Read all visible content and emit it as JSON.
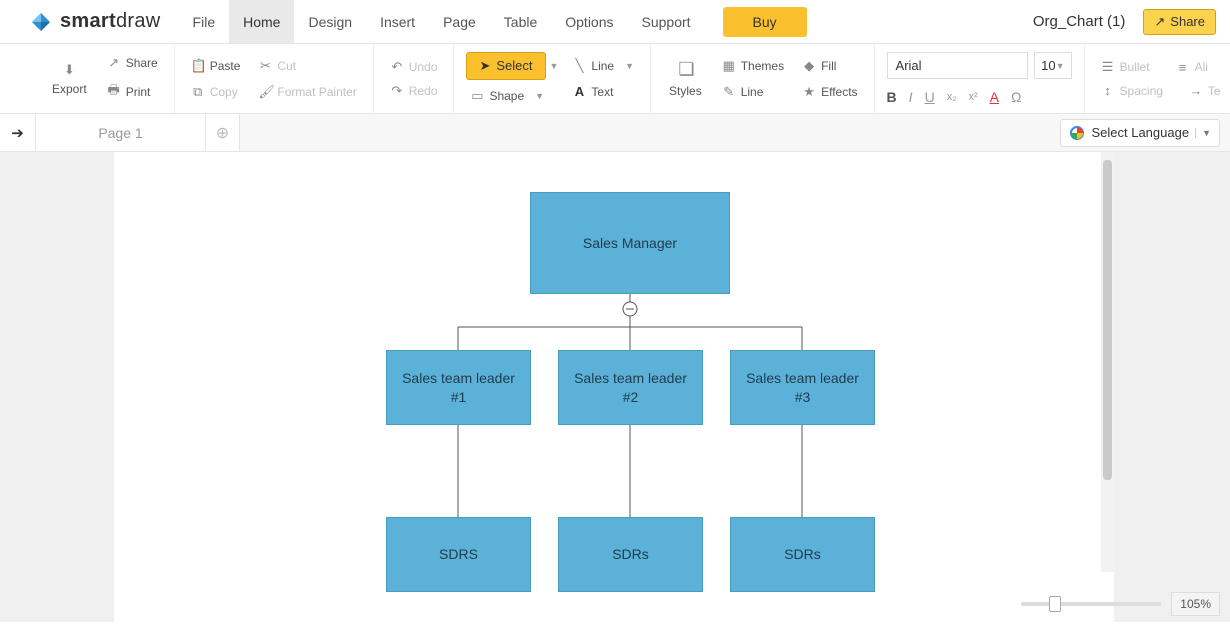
{
  "app": {
    "logo_name_1": "smart",
    "logo_name_2": "draw"
  },
  "menu": {
    "file": "File",
    "home": "Home",
    "design": "Design",
    "insert": "Insert",
    "page": "Page",
    "table": "Table",
    "options": "Options",
    "support": "Support",
    "buy": "Buy"
  },
  "top_right": {
    "doc_title": "Org_Chart (1)",
    "share": "Share"
  },
  "ribbon": {
    "export": "Export",
    "share": "Share",
    "print": "Print",
    "paste": "Paste",
    "cut": "Cut",
    "copy": "Copy",
    "format_painter": "Format Painter",
    "undo": "Undo",
    "redo": "Redo",
    "select": "Select",
    "shape": "Shape",
    "line": "Line",
    "text": "Text",
    "styles": "Styles",
    "themes": "Themes",
    "fill": "Fill",
    "line2": "Line",
    "effects": "Effects",
    "font": "Arial",
    "font_size": "10",
    "bullet": "Bullet",
    "align": "Ali",
    "spacing": "Spacing",
    "te": "Te"
  },
  "pages": {
    "tab1": "Page 1",
    "lang": "Select Language"
  },
  "chart": {
    "root": "Sales Manager",
    "lead1": "Sales team leader #1",
    "lead2": "Sales team leader #2",
    "lead3": "Sales team leader #3",
    "sdr1": "SDRS",
    "sdr2": "SDRs",
    "sdr3": "SDRs"
  },
  "zoom": {
    "label": "105%"
  }
}
